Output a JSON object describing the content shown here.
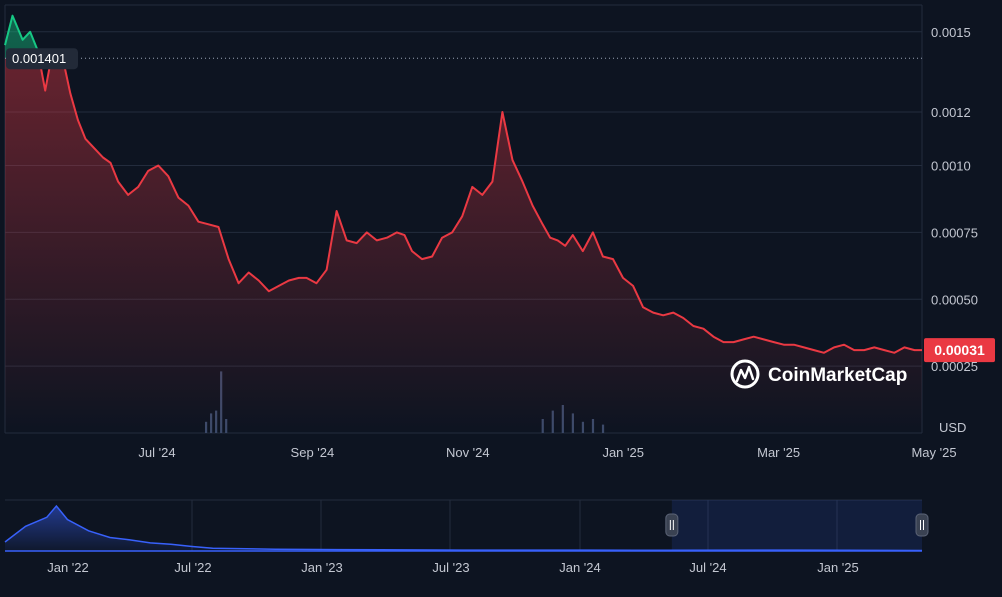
{
  "colors": {
    "background": "#0d1421",
    "grid": "#232c3d",
    "up": "#16c784",
    "down": "#ea3943",
    "navigator_line": "#3861fb",
    "volume": "#3c4a6a"
  },
  "watermark": "CoinMarketCap",
  "currency_label": "USD",
  "reference_line_label": "0.001401",
  "current_price_label": "0.00031",
  "chart_data": {
    "type": "area",
    "x_axis_ticks": [
      "Jul '24",
      "Sep '24",
      "Nov '24",
      "Jan '25",
      "Mar '25",
      "May '25"
    ],
    "y_axis_ticks": [
      "0.0015",
      "0.0012",
      "0.0010",
      "0.00075",
      "0.00050",
      "0.00025"
    ],
    "ylim": [
      0.0,
      0.0016
    ],
    "reference_value": 0.001401,
    "current_value": 0.00031,
    "grid": true,
    "series": [
      {
        "x": [
          "2024-05-01",
          "2024-05-04",
          "2024-05-08",
          "2024-05-11",
          "2024-05-14",
          "2024-05-17",
          "2024-05-20",
          "2024-05-24",
          "2024-05-27",
          "2024-05-30",
          "2024-06-02",
          "2024-06-06",
          "2024-06-09",
          "2024-06-12",
          "2024-06-15",
          "2024-06-19",
          "2024-06-23",
          "2024-06-27",
          "2024-07-01",
          "2024-07-05",
          "2024-07-09",
          "2024-07-13",
          "2024-07-17",
          "2024-07-21",
          "2024-07-25",
          "2024-07-29",
          "2024-08-02",
          "2024-08-06",
          "2024-08-10",
          "2024-08-14",
          "2024-08-18",
          "2024-08-22",
          "2024-08-26",
          "2024-08-29",
          "2024-09-02",
          "2024-09-06",
          "2024-09-10",
          "2024-09-14",
          "2024-09-18",
          "2024-09-22",
          "2024-09-26",
          "2024-09-30",
          "2024-10-04",
          "2024-10-07",
          "2024-10-10",
          "2024-10-14",
          "2024-10-18",
          "2024-10-22",
          "2024-10-26",
          "2024-10-30",
          "2024-11-03",
          "2024-11-07",
          "2024-11-11",
          "2024-11-15",
          "2024-11-19",
          "2024-11-23",
          "2024-11-27",
          "2024-12-01",
          "2024-12-04",
          "2024-12-07",
          "2024-12-10",
          "2024-12-13",
          "2024-12-17",
          "2024-12-21",
          "2024-12-25",
          "2024-12-29",
          "2025-01-02",
          "2025-01-06",
          "2025-01-10",
          "2025-01-14",
          "2025-01-18",
          "2025-01-22",
          "2025-01-26",
          "2025-01-30",
          "2025-02-03",
          "2025-02-07",
          "2025-02-11",
          "2025-02-15",
          "2025-02-19",
          "2025-02-23",
          "2025-02-27",
          "2025-03-03",
          "2025-03-07",
          "2025-03-11",
          "2025-03-15",
          "2025-03-19",
          "2025-03-23",
          "2025-03-27",
          "2025-03-31",
          "2025-04-04",
          "2025-04-08",
          "2025-04-12",
          "2025-04-16",
          "2025-04-20",
          "2025-04-24",
          "2025-04-28",
          "2025-05-01"
        ],
        "values": [
          0.00145,
          0.00156,
          0.00147,
          0.0015,
          0.00143,
          0.00128,
          0.00143,
          0.0014,
          0.00127,
          0.00117,
          0.0011,
          0.00106,
          0.00103,
          0.00101,
          0.00094,
          0.00089,
          0.00092,
          0.00098,
          0.001,
          0.00096,
          0.00088,
          0.00085,
          0.00079,
          0.00078,
          0.00077,
          0.00065,
          0.00056,
          0.0006,
          0.00057,
          0.00053,
          0.00055,
          0.00057,
          0.00058,
          0.00058,
          0.00056,
          0.00061,
          0.00083,
          0.00072,
          0.00071,
          0.00075,
          0.00072,
          0.00073,
          0.00075,
          0.00074,
          0.00068,
          0.00065,
          0.00066,
          0.00073,
          0.00075,
          0.00081,
          0.00092,
          0.00089,
          0.00094,
          0.0012,
          0.00102,
          0.00094,
          0.00085,
          0.00078,
          0.00073,
          0.00072,
          0.0007,
          0.00074,
          0.00068,
          0.00075,
          0.00066,
          0.00065,
          0.00058,
          0.00055,
          0.00047,
          0.00045,
          0.00044,
          0.00045,
          0.00043,
          0.0004,
          0.00039,
          0.00036,
          0.00034,
          0.00034,
          0.00035,
          0.00036,
          0.00035,
          0.00034,
          0.00033,
          0.00033,
          0.00032,
          0.00031,
          0.0003,
          0.00032,
          0.00033,
          0.00031,
          0.00031,
          0.00032,
          0.00031,
          0.0003,
          0.00032,
          0.00031,
          0.00031
        ]
      }
    ],
    "volume": {
      "x": [
        "2024-07-20",
        "2024-07-22",
        "2024-07-24",
        "2024-07-26",
        "2024-07-28",
        "2024-12-01",
        "2024-12-05",
        "2024-12-09",
        "2024-12-13",
        "2024-12-17",
        "2024-12-21",
        "2024-12-25"
      ],
      "values": [
        0.04,
        0.07,
        0.08,
        0.22,
        0.05,
        0.05,
        0.08,
        0.1,
        0.07,
        0.04,
        0.05,
        0.03
      ]
    },
    "navigator": {
      "x_axis_ticks": [
        "Jan '22",
        "Jul '22",
        "Jan '23",
        "Jul '23",
        "Jan '24",
        "Jul '24",
        "Jan '25"
      ],
      "selected_range": [
        "2024-05-01",
        "2025-05-01"
      ],
      "x": [
        "2021-09-01",
        "2021-10-01",
        "2021-11-01",
        "2021-11-15",
        "2021-12-01",
        "2022-01-01",
        "2022-02-01",
        "2022-03-01",
        "2022-04-01",
        "2022-05-01",
        "2022-06-01",
        "2022-07-01",
        "2022-10-01",
        "2023-01-01",
        "2023-07-01",
        "2024-01-01",
        "2024-05-01",
        "2024-11-01",
        "2025-05-01"
      ],
      "values": [
        0.2,
        0.55,
        0.75,
        1.0,
        0.7,
        0.45,
        0.3,
        0.25,
        0.18,
        0.15,
        0.1,
        0.06,
        0.04,
        0.03,
        0.02,
        0.02,
        0.015,
        0.02,
        0.01
      ]
    }
  }
}
